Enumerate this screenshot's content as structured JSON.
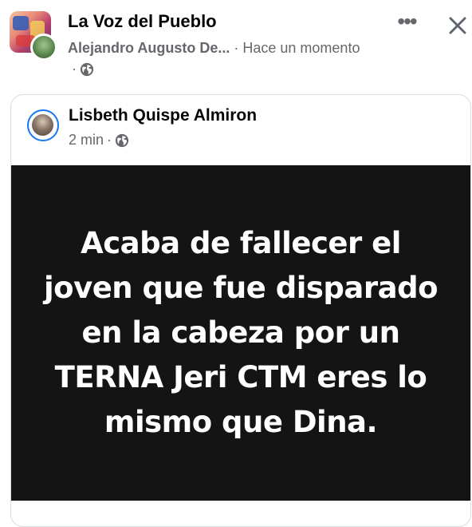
{
  "post": {
    "group_name": "La Voz del Pueblo",
    "author": "Alejandro Augusto De...",
    "separator": "·",
    "timestamp": "Hace un momento",
    "privacy_prefix": "·",
    "privacy_icon": "globe-icon",
    "more_icon": "more-options-icon",
    "close_icon": "close-icon"
  },
  "shared_post": {
    "author": "Lisbeth Quispe Almiron",
    "time": "2 min",
    "separator": "·",
    "privacy_icon": "globe-icon",
    "text": "Acaba de fallecer el joven que fue disparado en la cabeza por un TERNA Jeri CTM eres lo mismo que Dina.",
    "background_color": "#141414",
    "text_color": "#ffffff"
  },
  "colors": {
    "secondary_text": "#65676b",
    "accent_blue": "#1877f2",
    "card_border": "#dadde1"
  }
}
